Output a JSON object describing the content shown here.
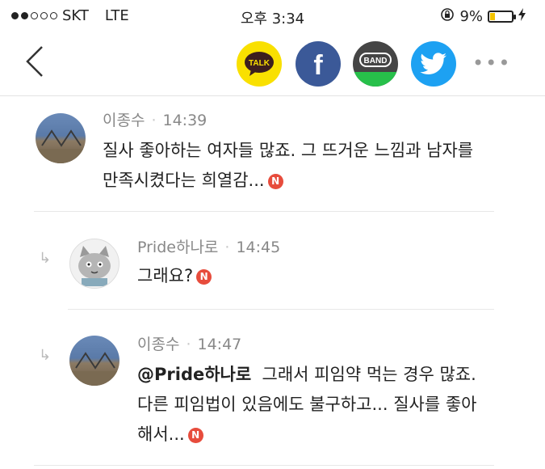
{
  "status_bar": {
    "carrier": "SKT",
    "network": "LTE",
    "time": "오후 3:34",
    "battery": "9%",
    "battery_level": 0.09
  },
  "share_bar": {
    "kakao_label": "TALK",
    "facebook_label": "f",
    "band_label": "BAND",
    "more_label": "•••",
    "colors": {
      "kakao": "#f9e000",
      "facebook": "#3b5998",
      "band": "#454545",
      "twitter": "#1da1f2"
    }
  },
  "comments": [
    {
      "author": "이종수",
      "time": "14:39",
      "lines": [
        "질사 좋아하는 여자들 많죠. 그 뜨거운 느낌과 남자를",
        "만족시켰다는 희열감..."
      ],
      "badge": "N",
      "is_reply": false
    },
    {
      "author": "Pride하나로",
      "time": "14:45",
      "lines": [
        "그래요?"
      ],
      "badge": "N",
      "is_reply": true
    },
    {
      "author": "이종수",
      "time": "14:47",
      "mention": "@Pride하나로",
      "lines": [
        "그래서 피임약 먹는 경우 많죠.",
        "다른 피임법이 있음에도 불구하고... 질사를 좋아",
        "해서..."
      ],
      "badge": "N",
      "is_reply": true
    }
  ],
  "reply_arrow": "↳",
  "icons": [
    "back-chevron-icon",
    "kakaotalk-icon",
    "facebook-icon",
    "band-icon",
    "twitter-icon",
    "more-icon",
    "new-badge-icon",
    "reply-arrow-icon"
  ]
}
